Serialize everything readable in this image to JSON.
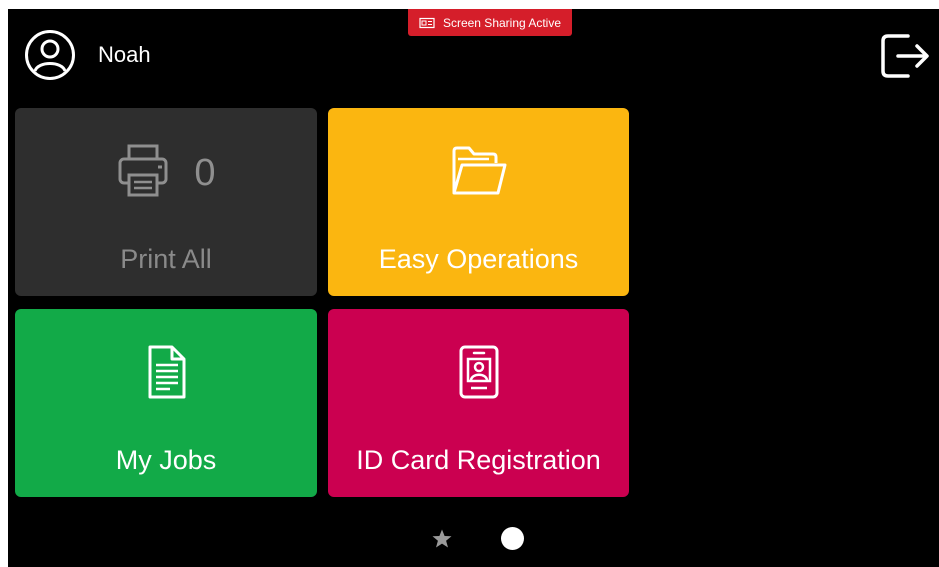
{
  "banner": {
    "label": "Screen Sharing Active",
    "icon": "screen-share-icon",
    "color": "#d51e2a"
  },
  "header": {
    "user_name": "Noah",
    "avatar_icon": "user-avatar-icon",
    "logout_icon": "logout-icon"
  },
  "tiles": [
    {
      "id": "print-all",
      "label": "Print All",
      "icon": "printer-icon",
      "count": "0",
      "color": "#2e2e2e",
      "enabled": false
    },
    {
      "id": "easy-operations",
      "label": "Easy Operations",
      "icon": "folder-icon",
      "color": "#fbb610",
      "enabled": true
    },
    {
      "id": "my-jobs",
      "label": "My Jobs",
      "icon": "document-icon",
      "color": "#12aa48",
      "enabled": true
    },
    {
      "id": "id-card-registration",
      "label": "ID Card Registration",
      "icon": "id-card-icon",
      "color": "#cb0050",
      "enabled": true
    }
  ],
  "pager": {
    "pages": [
      "favorites",
      "main"
    ],
    "active_page": 2
  }
}
